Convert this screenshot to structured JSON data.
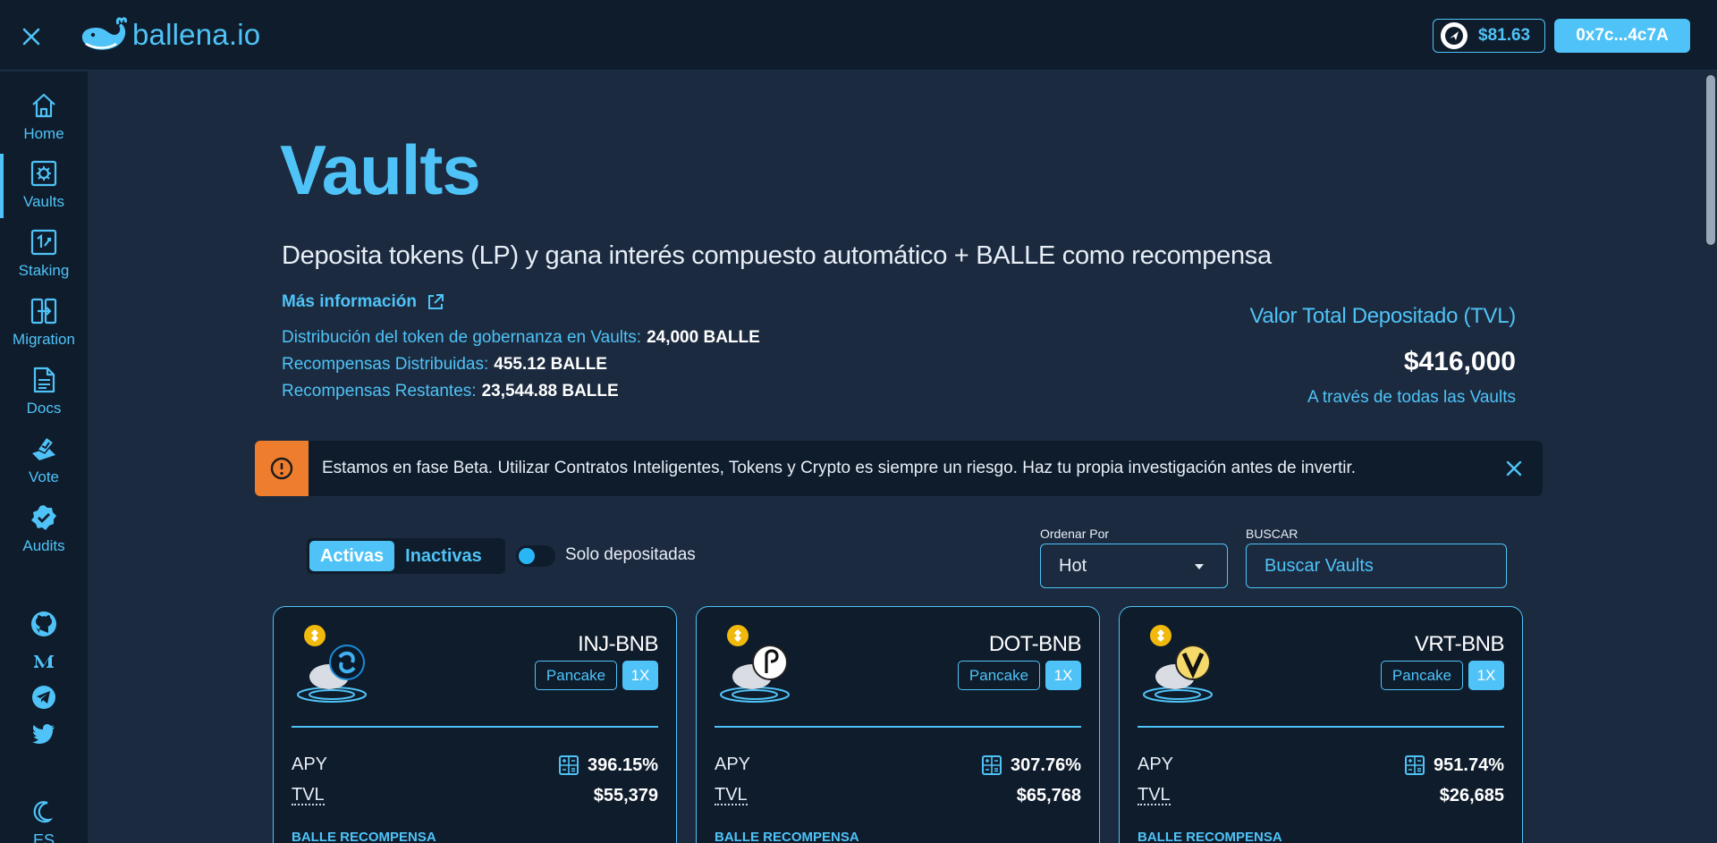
{
  "topbar": {
    "logo_text": "ballena.io",
    "token_price": "$81.63",
    "wallet": "0x7c...4c7A"
  },
  "sidebar": {
    "items": [
      {
        "label": "Home",
        "icon": "home-icon"
      },
      {
        "label": "Vaults",
        "icon": "vault-icon"
      },
      {
        "label": "Staking",
        "icon": "staking-icon"
      },
      {
        "label": "Migration",
        "icon": "migration-icon"
      },
      {
        "label": "Docs",
        "icon": "docs-icon"
      },
      {
        "label": "Vote",
        "icon": "vote-icon"
      },
      {
        "label": "Audits",
        "icon": "audits-icon"
      }
    ],
    "social": [
      "github-icon",
      "medium-icon",
      "telegram-icon",
      "twitter-icon"
    ],
    "lang": "ES",
    "theme_icon": "moon-icon"
  },
  "header": {
    "title": "Vaults",
    "subtitle": "Deposita tokens (LP) y gana interés compuesto automático + BALLE como recompensa",
    "more_info": "Más información",
    "stats": [
      {
        "label": "Distribución del token de gobernanza en Vaults:",
        "value": "24,000 BALLE"
      },
      {
        "label": "Recompensas Distribuidas:",
        "value": "455.12 BALLE"
      },
      {
        "label": "Recompensas Restantes:",
        "value": "23,544.88 BALLE"
      }
    ],
    "tvl": {
      "title": "Valor Total Depositado (TVL)",
      "value": "$416,000",
      "sub": "A través de todas las Vaults"
    }
  },
  "beta": {
    "text": "Estamos en fase Beta. Utilizar Contratos Inteligentes, Tokens y Crypto es siempre un riesgo. Haz tu propia investigación antes de invertir."
  },
  "filters": {
    "active_label": "Activas",
    "inactive_label": "Inactivas",
    "only_deposited": "Solo depositadas",
    "sort_label": "Ordenar Por",
    "sort_value": "Hot",
    "search_label": "BUSCAR",
    "search_placeholder": "Buscar Vaults"
  },
  "vaults": [
    {
      "name": "INJ-BNB",
      "platform": "Pancake",
      "multiplier": "1X",
      "apy_label": "APY",
      "apy": "396.15%",
      "tvl_label": "TVL",
      "tvl": "$55,379",
      "reward_label": "BALLE RECOMPENSA",
      "token_color": "#1a8bd8"
    },
    {
      "name": "DOT-BNB",
      "platform": "Pancake",
      "multiplier": "1X",
      "apy_label": "APY",
      "apy": "307.76%",
      "tvl_label": "TVL",
      "tvl": "$65,768",
      "reward_label": "BALLE RECOMPENSA",
      "token_color": "#ffffff"
    },
    {
      "name": "VRT-BNB",
      "platform": "Pancake",
      "multiplier": "1X",
      "apy_label": "APY",
      "apy": "951.74%",
      "tvl_label": "TVL",
      "tvl": "$26,685",
      "reward_label": "BALLE RECOMPENSA",
      "token_color": "#f5d96b"
    }
  ],
  "colors": {
    "accent": "#4fc3f7",
    "background": "#1b2a3f",
    "panel": "#0f1c2c",
    "warning": "#ef7d2e"
  }
}
